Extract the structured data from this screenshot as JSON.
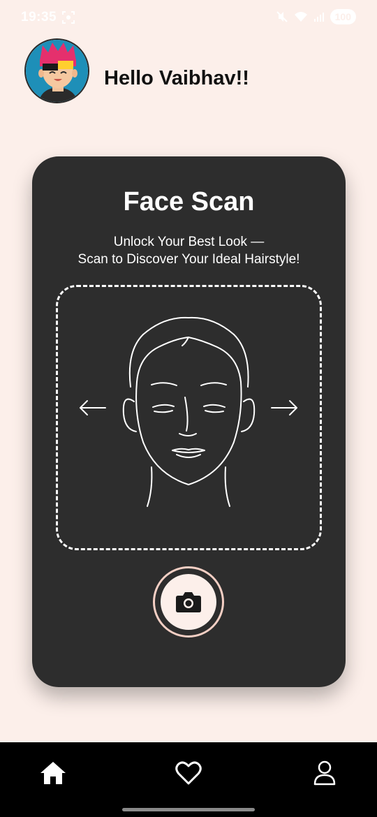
{
  "status_bar": {
    "time": "19:35",
    "battery": "100",
    "icons": [
      "screen-record-icon",
      "mute-icon",
      "wifi-icon",
      "signal-icon",
      "battery-icon"
    ]
  },
  "header": {
    "greeting": "Hello Vaibhav!!",
    "avatar_icon": "cartoon-avatar"
  },
  "scan_card": {
    "title": "Face Scan",
    "subtitle_line1": "Unlock Your Best Look —",
    "subtitle_line2": "Scan to Discover Your Ideal Hairstyle!",
    "illustration": "face-outline-with-arrows",
    "capture_icon": "camera-icon"
  },
  "bottom_nav": {
    "items": [
      {
        "icon": "home-icon",
        "active": true
      },
      {
        "icon": "heart-icon",
        "active": false
      },
      {
        "icon": "profile-icon",
        "active": false
      }
    ]
  },
  "colors": {
    "background": "#fcefea",
    "card": "#2d2d2d",
    "nav": "#000000",
    "accent_ring": "#f4cfc4",
    "text_dark": "#111111",
    "text_light": "#ffffff"
  }
}
